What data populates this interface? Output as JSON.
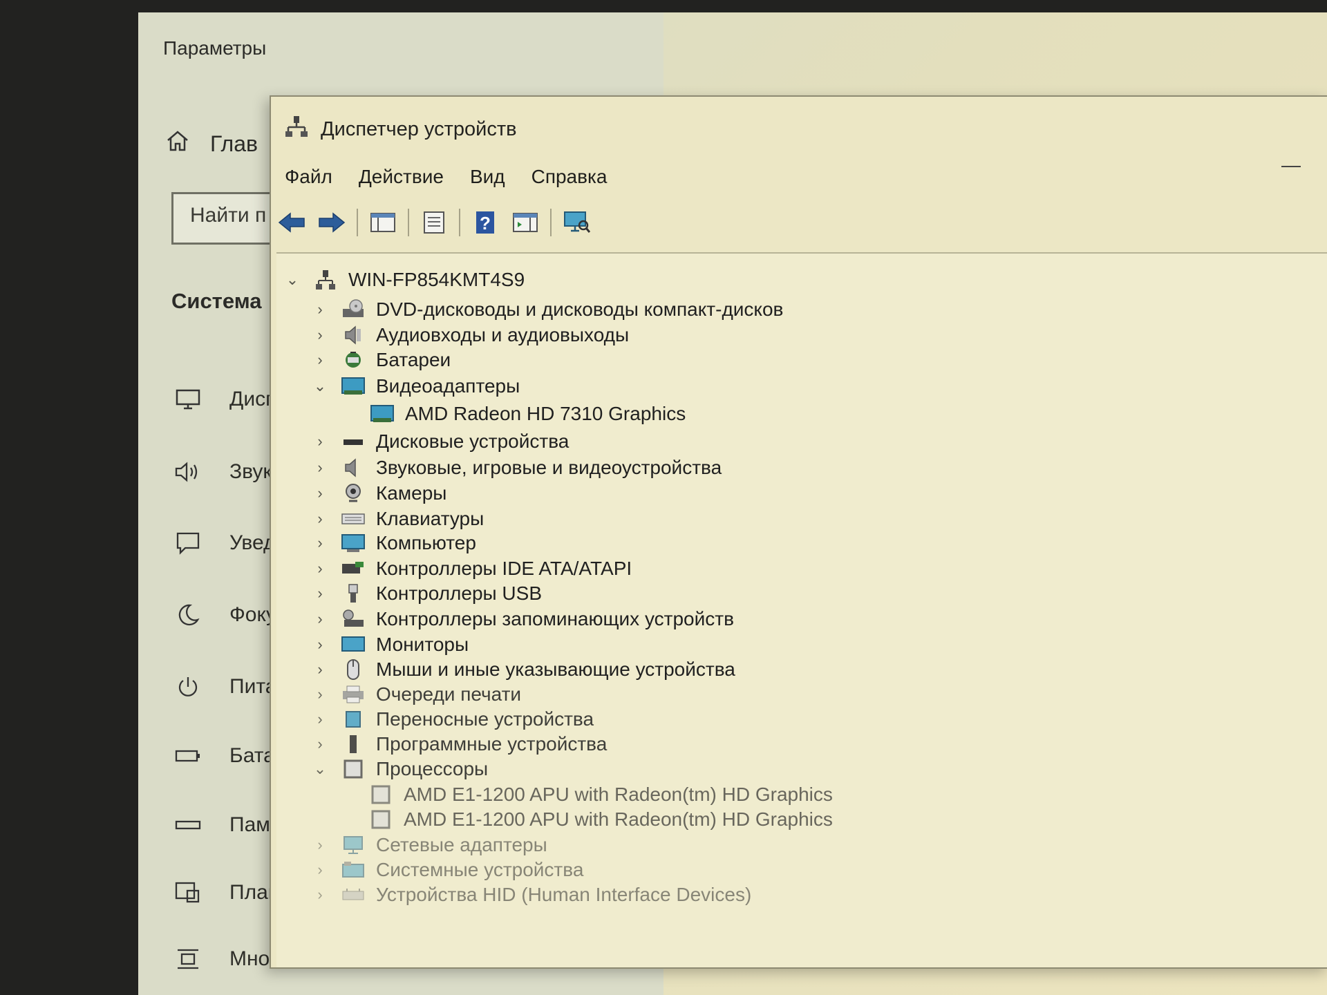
{
  "settings": {
    "title": "Параметры",
    "home_label": "Глав",
    "search_placeholder": "Найти п",
    "section_heading": "Система",
    "nav": [
      {
        "label": "Дисп",
        "icon": "monitor-icon"
      },
      {
        "label": "Звук",
        "icon": "speaker-icon"
      },
      {
        "label": "Увед",
        "icon": "notification-icon"
      },
      {
        "label": "Фоку",
        "icon": "moon-icon"
      },
      {
        "label": "Пита",
        "icon": "power-icon"
      },
      {
        "label": "Батар",
        "icon": "battery-icon"
      },
      {
        "label": "Памя",
        "icon": "storage-icon"
      },
      {
        "label": "План",
        "icon": "tablet-icon"
      },
      {
        "label": "Мно",
        "icon": "multitask-icon"
      }
    ]
  },
  "devmgr": {
    "title": "Диспетчер устройств",
    "menu": [
      "Файл",
      "Действие",
      "Вид",
      "Справка"
    ],
    "root": "WIN-FP854KMT4S9",
    "categories": [
      {
        "label": "DVD-дисководы и дисководы компакт-дисков",
        "icon": "dvd-icon",
        "expanded": false
      },
      {
        "label": "Аудиовходы и аудиовыходы",
        "icon": "audio-icon",
        "expanded": false
      },
      {
        "label": "Батареи",
        "icon": "battery-icon",
        "expanded": false
      },
      {
        "label": "Видеоадаптеры",
        "icon": "display-adapter-icon",
        "expanded": true,
        "children": [
          "AMD Radeon HD 7310 Graphics"
        ]
      },
      {
        "label": "Дисковые устройства",
        "icon": "disk-icon",
        "expanded": false
      },
      {
        "label": "Звуковые, игровые и видеоустройства",
        "icon": "sound-icon",
        "expanded": false
      },
      {
        "label": "Камеры",
        "icon": "camera-icon",
        "expanded": false
      },
      {
        "label": "Клавиатуры",
        "icon": "keyboard-icon",
        "expanded": false
      },
      {
        "label": "Компьютер",
        "icon": "computer-icon",
        "expanded": false
      },
      {
        "label": "Контроллеры IDE ATA/ATAPI",
        "icon": "ide-icon",
        "expanded": false
      },
      {
        "label": "Контроллеры USB",
        "icon": "usb-icon",
        "expanded": false
      },
      {
        "label": "Контроллеры запоминающих устройств",
        "icon": "storage-controller-icon",
        "expanded": false
      },
      {
        "label": "Мониторы",
        "icon": "monitor-icon",
        "expanded": false
      },
      {
        "label": "Мыши и иные указывающие устройства",
        "icon": "mouse-icon",
        "expanded": false
      },
      {
        "label": "Очереди печати",
        "icon": "printer-icon",
        "expanded": false
      },
      {
        "label": "Переносные устройства",
        "icon": "portable-icon",
        "expanded": false
      },
      {
        "label": "Программные устройства",
        "icon": "software-device-icon",
        "expanded": false
      },
      {
        "label": "Процессоры",
        "icon": "cpu-icon",
        "expanded": true,
        "children": [
          "AMD E1-1200 APU with Radeon(tm) HD Graphics",
          "AMD E1-1200 APU with Radeon(tm) HD Graphics"
        ]
      },
      {
        "label": "Сетевые адаптеры",
        "icon": "network-icon",
        "expanded": false
      },
      {
        "label": "Системные устройства",
        "icon": "system-icon",
        "expanded": false
      },
      {
        "label": "Устройства HID (Human Interface Devices)",
        "icon": "hid-icon",
        "expanded": false
      }
    ]
  }
}
